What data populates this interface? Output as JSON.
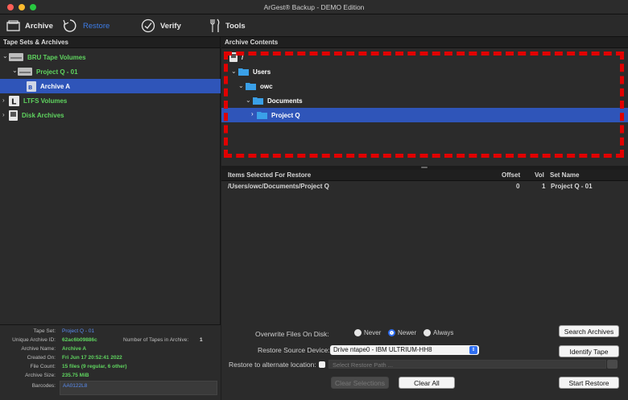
{
  "window": {
    "title": "ArGest® Backup - DEMO Edition",
    "lights": [
      "#ff5f57",
      "#febc2e",
      "#28c840"
    ]
  },
  "toolbar": {
    "items": [
      {
        "label": "Archive",
        "icon": "archive-icon"
      },
      {
        "label": "Restore",
        "icon": "restore-icon"
      },
      {
        "label": "Verify",
        "icon": "verify-icon"
      },
      {
        "label": "Tools",
        "icon": "tools-icon"
      }
    ]
  },
  "left": {
    "header": "Tape Sets & Archives",
    "tree": [
      {
        "label": "BRU Tape Volumes"
      },
      {
        "label": "Project Q - 01"
      },
      {
        "label": "Archive A"
      },
      {
        "label": "LTFS Volumes"
      },
      {
        "label": "Disk Archives"
      }
    ],
    "info": {
      "tape_set_label": "Tape Set:",
      "tape_set": "Project Q - 01",
      "unique_id_label": "Unique Archive ID:",
      "unique_id": "62ac6b09886c",
      "num_tapes_label": "Number of Tapes in Archive:",
      "num_tapes": "1",
      "archive_name_label": "Archive Name:",
      "archive_name": "Archive A",
      "created_label": "Created On:",
      "created": "Fri Jun 17 20:52:41 2022",
      "file_count_label": "File Count:",
      "file_count": "15 files (9 regular, 6 other)",
      "archive_size_label": "Archive Size:",
      "archive_size": "235.75 MiB",
      "barcodes_label": "Barcodes:",
      "barcodes": "AA0122L8"
    }
  },
  "right": {
    "header": "Archive Contents",
    "tree": [
      {
        "label": "/"
      },
      {
        "label": "Users"
      },
      {
        "label": "owc"
      },
      {
        "label": "Documents"
      },
      {
        "label": "Project Q"
      }
    ],
    "items": {
      "columns": {
        "name": "Items Selected For Restore",
        "offset": "Offset",
        "vol": "Vol",
        "set": "Set Name"
      },
      "rows": [
        {
          "path": "/Users/owc/Documents/Project Q",
          "offset": "0",
          "vol": "1",
          "set": "Project Q - 01"
        }
      ]
    },
    "controls": {
      "overwrite_label": "Overwrite Files On Disk:",
      "overwrite_options": [
        "Never",
        "Newer",
        "Always"
      ],
      "overwrite_selected": "Newer",
      "source_label": "Restore Source Device:",
      "source_value": "Drive ntape0 - IBM ULTRIUM-HH8",
      "alt_location_label": "Restore to alternate location:",
      "alt_path_placeholder": "Select Restore Path ...",
      "search_button": "Search Archives",
      "identify_button": "Identify Tape",
      "clear_selections_button": "Clear Selections",
      "clear_all_button": "Clear All",
      "start_button": "Start Restore"
    }
  }
}
